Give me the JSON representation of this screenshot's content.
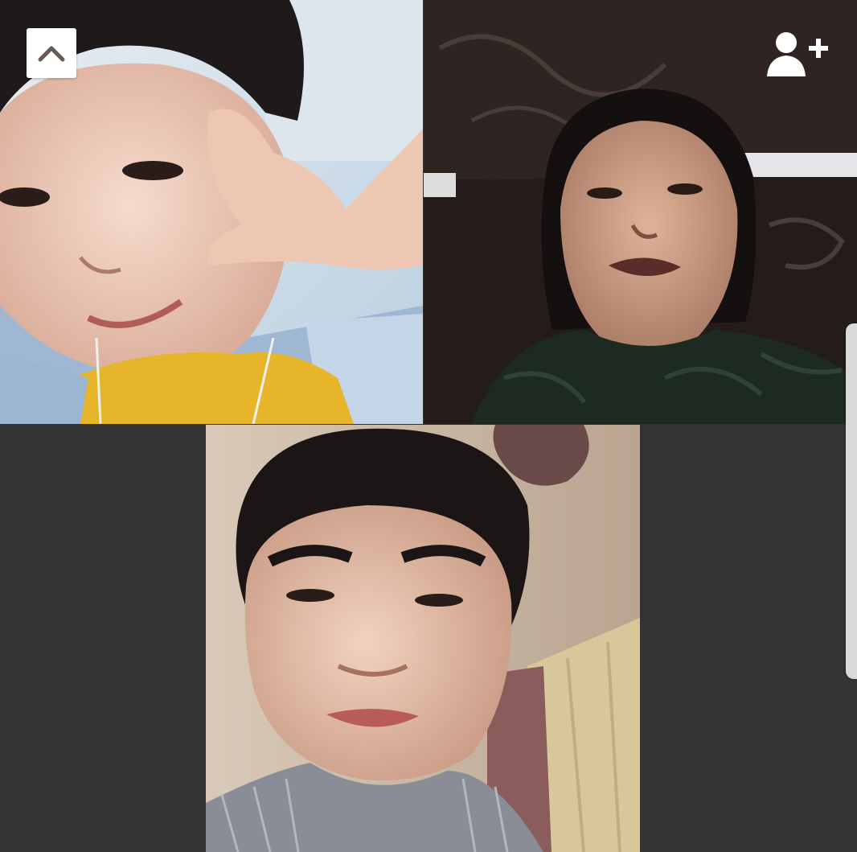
{
  "app": {
    "background_color": "#333333",
    "accent_icon_color": "#ffffff",
    "collapse_icon_color": "#6b5a56"
  },
  "controls": {
    "collapse_button": {
      "icon": "chevron-up-icon"
    },
    "add_participant_button": {
      "icon": "add-person-icon"
    },
    "side_panel_handle": {
      "color": "#d9d9d9"
    }
  },
  "participants": [
    {
      "tile": "top-left",
      "description_icon": "video-feed",
      "shirt_color": "#e7b52a",
      "wall_color": "#c8dbe8"
    },
    {
      "tile": "top-right",
      "description_icon": "video-feed",
      "shirt_color": "#1d2a22",
      "wall_color": "#2a2220"
    },
    {
      "tile": "bottom-center",
      "description_icon": "video-feed",
      "shirt_color": "#8a8d97",
      "wall_color": "#c9b8a6"
    }
  ]
}
